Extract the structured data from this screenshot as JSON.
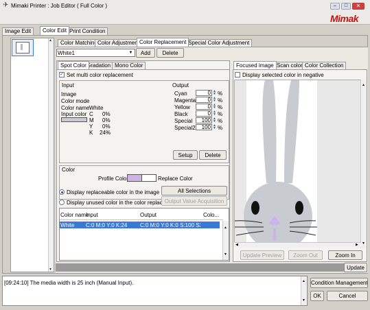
{
  "window": {
    "title": "Mimaki Printer : Job Editor ( Full Color )",
    "brand": "Mimak"
  },
  "main_tabs": [
    "Image Edit",
    "Color Edit",
    "Print Condition"
  ],
  "sub_tabs": [
    "Color Matching",
    "Color Adjustment",
    "Color Replacement",
    "Special Color Adjustment"
  ],
  "color_select": {
    "value": "White1"
  },
  "add_label": "Add",
  "delete_label": "Delete",
  "spot_tabs": [
    "Spot Color",
    "Gradation",
    "Mono Color"
  ],
  "multi_replace": "Set multi color replacement",
  "input": {
    "heading": "Input",
    "image": "Image",
    "color_mode": "Color mode",
    "color_name_label": "Color name",
    "color_name": "White",
    "input_color_label": "Input color",
    "channels": [
      {
        "k": "C",
        "v": "0%"
      },
      {
        "k": "M",
        "v": "0%"
      },
      {
        "k": "Y",
        "v": "0%"
      },
      {
        "k": "K",
        "v": "24%"
      }
    ]
  },
  "output": {
    "heading": "Output",
    "unit": "%",
    "rows": [
      {
        "label": "Cyan",
        "value": "0"
      },
      {
        "label": "Magenta",
        "value": "0"
      },
      {
        "label": "Yellow",
        "value": "0"
      },
      {
        "label": "Black",
        "value": "0"
      },
      {
        "label": "Special",
        "value": "100"
      },
      {
        "label": "Special2",
        "value": "100"
      }
    ]
  },
  "setup_label": "Setup",
  "delete2_label": "Delete",
  "color_group": {
    "heading": "Color",
    "profile_color": "Profile Color",
    "replace_color": "Replace Color",
    "profile_swatch": "#cdb3e6",
    "replace_swatch": "#ffffff"
  },
  "radio_display_replaceable": "Display replaceable color in the image",
  "radio_display_unused": "Display unused color in the color replac...",
  "all_selections": "All Selections",
  "output_value_acq": "Output Value Acquisition",
  "table": {
    "headers": [
      "Color name",
      "Input",
      "Output",
      "Colo..."
    ],
    "rows": [
      {
        "name": "White",
        "input": "C:0 M:0 Y:0 K:24",
        "output": "C:0 M:0 Y:0 K:0 S:100 S2...."
      }
    ]
  },
  "right_tabs": [
    "Focused image",
    "Scan color",
    "Color Collection"
  ],
  "negative_label": "Display selected color in negative",
  "update_preview": "Update Preview",
  "zoom_out": "Zoom Out",
  "zoom_in": "Zoom In",
  "update": "Update",
  "log": "[09:24:10] The media width is 25 inch (Manual Input).",
  "condition_mgmt": "Condition Management",
  "ok": "OK",
  "cancel": "Cancel",
  "colors": {
    "titlebar": "#e8e6e2",
    "selection": "#3a78d8",
    "brand_red": "#cc1010",
    "rabbit": "#c8cbcf",
    "nose": "#c9b5ec"
  }
}
